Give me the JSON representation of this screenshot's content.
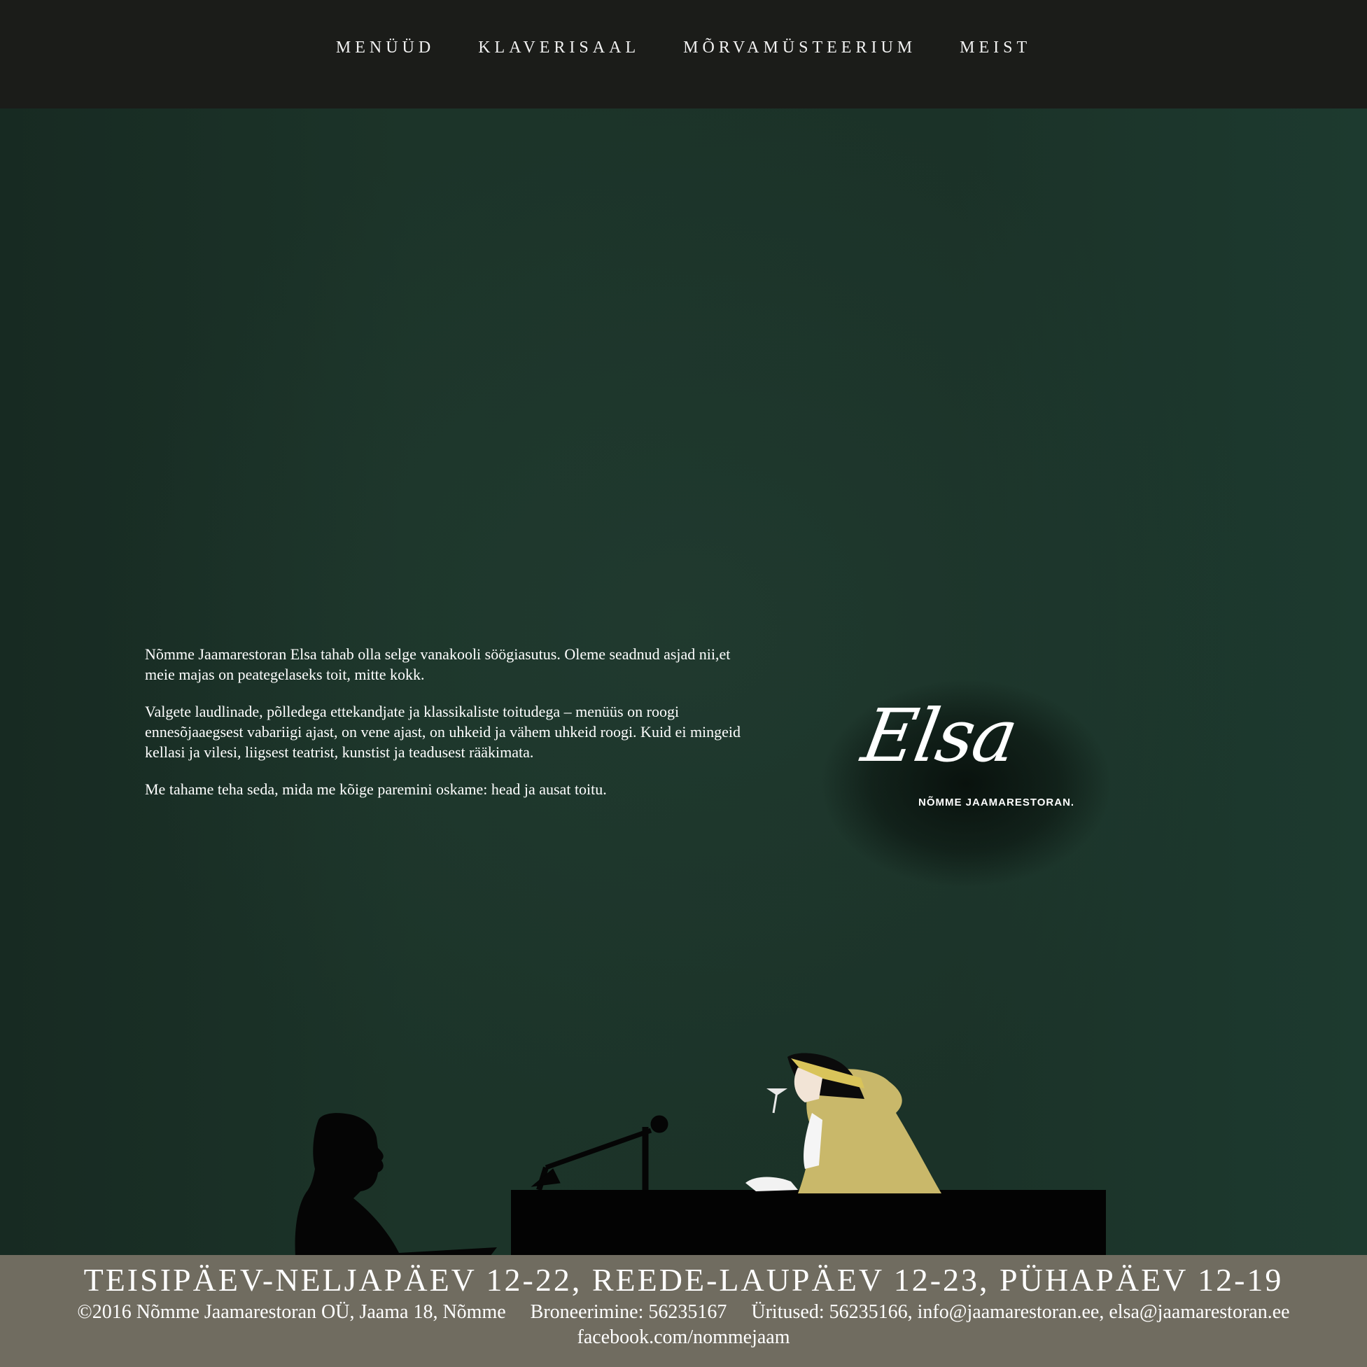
{
  "nav": {
    "items": [
      "MENÜÜD",
      "KLAVERISAAL",
      "MÕRVAMÜSTEERIUM",
      "MEIST"
    ]
  },
  "intro": {
    "paragraphs": [
      "Nõmme Jaamarestoran Elsa tahab olla selge vanakooli söögiasutus. Oleme seadnud asjad nii,et meie majas on peategelaseks toit, mitte kokk.",
      "Valgete laudlinade, põlledega ettekandjate ja klassikaliste toitudega – menüüs on roogi ennesõjaaegsest vabariigi ajast, on vene ajast, on uhkeid ja vähem uhkeid roogi. Kuid ei mingeid kellasi ja vilesi, liigsest teatrist, kunstist ja teadusest rääkimata.",
      "Me tahame teha seda, mida me kõige paremini oskame: head ja ausat toitu."
    ]
  },
  "logo": {
    "script": "Elsa",
    "subtitle": "NÕMME JAAMARESTORAN."
  },
  "footer": {
    "hours": "TEISIPÄEV-NELJAPÄEV 12-22, REEDE-LAUPÄEV 12-23, PÜHAPÄEV 12-19",
    "copyright": "©2016 Nõmme Jaamarestoran OÜ,  Jaama 18, Nõmme",
    "booking": "Broneerimine: 56235167",
    "events": "Üritused: 56235166,  info@jaamarestoran.ee, elsa@jaamarestoran.ee",
    "facebook": "facebook.com/nommejaam"
  },
  "colors": {
    "nav_bg": "#1b1c19",
    "hero_bg": "#1b3127",
    "footer_bg": "#706c60",
    "lady_coat": "#c9b86a"
  },
  "illustration": {
    "figures": [
      "pianist-silhouette",
      "piano",
      "microphone",
      "lady-with-glass"
    ]
  }
}
